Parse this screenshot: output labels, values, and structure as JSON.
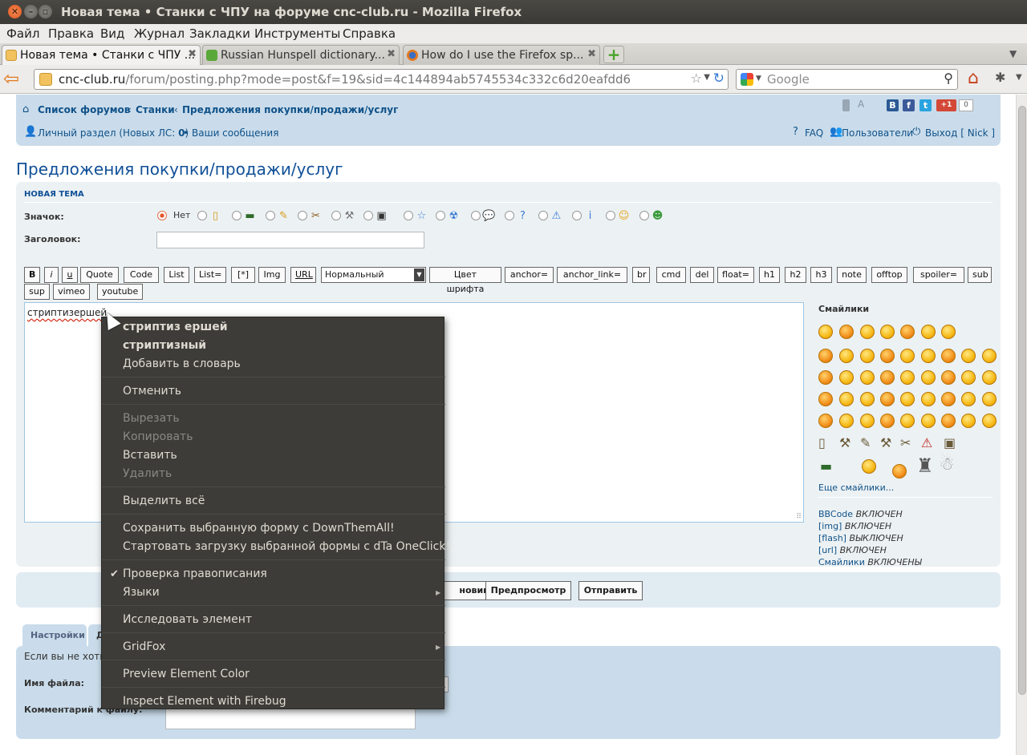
{
  "window": {
    "title": "Новая тема • Станки с ЧПУ на форуме cnc-club.ru - Mozilla Firefox",
    "close": "✕",
    "min": "–",
    "max": "▫"
  },
  "menubar": [
    "Файл",
    "Правка",
    "Вид",
    "Журнал",
    "Закладки",
    "Инструменты",
    "Справка"
  ],
  "tabs": [
    {
      "title": "Новая тема • Станки с ЧПУ ...",
      "close": "✖",
      "active": true
    },
    {
      "title": "Russian Hunspell dictionary...",
      "close": "✖",
      "active": false
    },
    {
      "title": "How do I use the Firefox sp...",
      "close": "✖",
      "active": false
    }
  ],
  "new_tab_label": "+",
  "url": {
    "host": "cnc-club.ru",
    "path": "/forum/posting.php?mode=post&f=19&sid=4c144894ab5745534c332c6d20eafdd6"
  },
  "search": {
    "placeholder": "Google"
  },
  "forum": {
    "breadcrumb": [
      "Список форумов",
      "Станки",
      "Предложения покупки/продажи/услуг"
    ],
    "breadcrumb_sep": "‹",
    "font_size_label": "A",
    "social_count": "0",
    "pm_link": "Личный раздел (Новых ЛС: ",
    "pm_count": "0",
    "pm_close": ")",
    "bullet": "•",
    "posts_link": "Ваши сообщения",
    "faq": "FAQ",
    "users": "Пользователи",
    "logout": "Выход [ Nick ]",
    "page_title": "Предложения покупки/продажи/услуг"
  },
  "post_form": {
    "section_title": "Новая тема",
    "icon_label": "Значок:",
    "icon_none": "Нет",
    "subject_label": "Заголовок:",
    "bbcode_row1": [
      "B",
      "i",
      "u",
      "Quote",
      "Code",
      "List",
      "List=",
      "[*]",
      "Img",
      "URL"
    ],
    "font_size_select": "Нормальный",
    "bbcode_row1b": [
      "Цвет шрифта",
      "anchor=",
      "anchor_link=",
      "br",
      "cmd",
      "del",
      "float=",
      "h1",
      "h2",
      "h3",
      "note",
      "offtop",
      "spoiler=",
      "sub"
    ],
    "bbcode_row2": [
      "sup",
      "vimeo",
      "youtube"
    ],
    "message_text": "стриптизершей",
    "smilies_title": "Смайлики",
    "more_smilies": "Еще смайлики...",
    "status": [
      {
        "key": "BBCode",
        "value": "ВКЛЮЧЕН"
      },
      {
        "key": "[img]",
        "value": "ВКЛЮЧЕН"
      },
      {
        "key": "[flash]",
        "value": "ВЫКЛЮЧЕН"
      },
      {
        "key": "[url]",
        "value": "ВКЛЮЧЕН"
      },
      {
        "key": "Смайлики",
        "value": "ВКЛЮЧЕНЫ"
      }
    ],
    "draft_button": "Черновик",
    "draft_visible": "новик",
    "preview_button": "Предпросмотр",
    "submit_button": "Отправить"
  },
  "options": {
    "tabs": [
      "Настройки",
      "Д"
    ],
    "note": "Если вы не хоть",
    "file_label": "Имя файла:",
    "comment_label": "Комментарий к файлу:"
  },
  "context_menu": {
    "items": [
      {
        "label": "стриптиз ершей",
        "style": "bold"
      },
      {
        "label": "стриптизный",
        "style": "bold"
      },
      {
        "label": "Добавить в словарь",
        "style": "normal"
      },
      {
        "label": "Отменить",
        "style": "normal"
      },
      {
        "label": "Вырезать",
        "style": "disabled"
      },
      {
        "label": "Копировать",
        "style": "disabled"
      },
      {
        "label": "Вставить",
        "style": "normal"
      },
      {
        "label": "Удалить",
        "style": "disabled"
      },
      {
        "label": "Выделить всё",
        "style": "normal"
      },
      {
        "label": "Сохранить выбранную форму с DownThemAll!",
        "style": "normal"
      },
      {
        "label": "Стартовать загрузку выбранной формы с dTa OneClick!",
        "style": "normal"
      },
      {
        "label": "Проверка правописания",
        "style": "checked"
      },
      {
        "label": "Языки",
        "style": "submenu"
      },
      {
        "label": "Исследовать элемент",
        "style": "normal"
      },
      {
        "label": "GridFox",
        "style": "submenu"
      },
      {
        "label": "Preview Element Color",
        "style": "normal"
      },
      {
        "label": "Inspect Element with Firebug",
        "style": "normal"
      }
    ]
  },
  "colors": {
    "forum_header": "#cadceb",
    "link": "#105289",
    "title": "#115098",
    "context_menu_bg": "#3d3c38"
  }
}
